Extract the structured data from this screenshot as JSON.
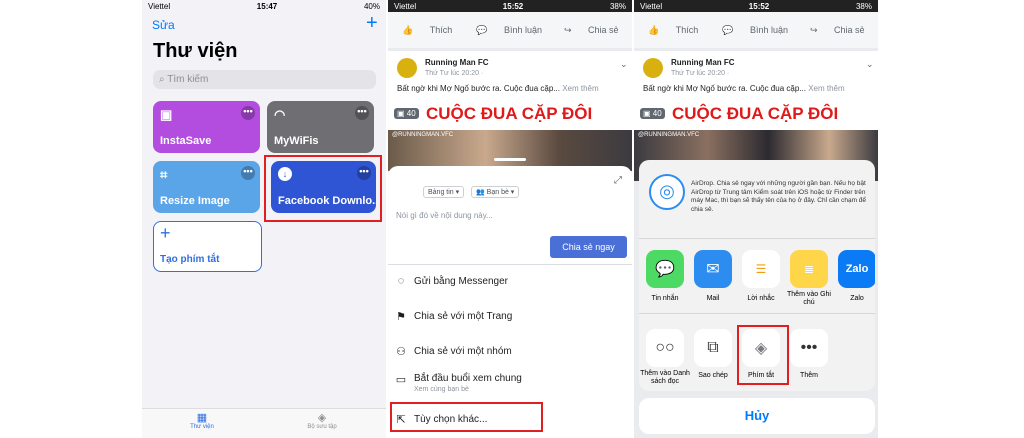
{
  "panel1": {
    "status": {
      "carrier": "Viettel",
      "time": "15:47",
      "battery": "40%"
    },
    "edit_label": "Sửa",
    "add_icon": "plus-icon",
    "title": "Thư viện",
    "search_placeholder": "Tìm kiếm",
    "shortcuts": [
      {
        "label": "InstaSave",
        "color": "#b34de0",
        "icon": "photo-icon"
      },
      {
        "label": "MyWiFis",
        "color": "#6e6e73",
        "icon": "wifi-icon"
      },
      {
        "label": "Resize Image",
        "color": "#5aa5e8",
        "icon": "crop-icon"
      },
      {
        "label": "Facebook Downlo...",
        "color": "#2f55d4",
        "icon": "download-icon"
      }
    ],
    "create_label": "Tạo phím tắt",
    "tabs": [
      {
        "label": "Thư viện",
        "icon": "grid-icon",
        "active": true
      },
      {
        "label": "Bộ sưu tập",
        "icon": "layers-icon",
        "active": false
      }
    ]
  },
  "panel2": {
    "status": {
      "carrier": "Viettel",
      "time": "15:52",
      "battery": "38%"
    },
    "actions": [
      "Thích",
      "Bình luận",
      "Chia sẻ"
    ],
    "post": {
      "page": "Running Man FC",
      "time": "Thứ Tư lúc 20:20 · ",
      "text": "Bất ngờ khi Mợ Ngố bước ra. Cuộc đua cặp...",
      "more": "Xem thêm",
      "count": "40",
      "banner": "CUỘC ĐUA CẶP ĐÔI",
      "watermark": "@RUNNINGMAN.VFC"
    },
    "sheet": {
      "audience1": "Bảng tin",
      "audience2": "Bạn bè",
      "placeholder": "Nói gì đó về nội dung này...",
      "share_now": "Chia sẻ ngay",
      "menu": [
        {
          "label": "Gửi bằng Messenger",
          "sub": "",
          "icon": "messenger-icon"
        },
        {
          "label": "Chia sẻ với một Trang",
          "sub": "",
          "icon": "flag-icon"
        },
        {
          "label": "Chia sẻ với một nhóm",
          "sub": "",
          "icon": "group-icon"
        },
        {
          "label": "Bắt đầu buổi xem chung",
          "sub": "Xem cùng bạn bè",
          "icon": "watch-party-icon"
        },
        {
          "label": "Tùy chọn khác...",
          "sub": "",
          "icon": "share-out-icon"
        }
      ]
    }
  },
  "panel3": {
    "status": {
      "carrier": "Viettel",
      "time": "15:52",
      "battery": "38%"
    },
    "actions": [
      "Thích",
      "Bình luận",
      "Chia sẻ"
    ],
    "post": {
      "page": "Running Man FC",
      "time": "Thứ Tư lúc 20:20 · ",
      "text": "Bất ngờ khi Mợ Ngố bước ra. Cuộc đua cặp...",
      "more": "Xem thêm",
      "count": "40",
      "banner": "CUỘC ĐUA CẶP ĐÔI",
      "watermark": "@RUNNINGMAN.VFC"
    },
    "airdrop_text": "AirDrop. Chia sẻ ngay với những người gần bạn. Nếu họ bật AirDrop từ Trung tâm Kiểm soát trên iOS hoặc từ Finder trên máy Mac, thì bạn sẽ thấy tên của họ ở đây. Chỉ cần chạm để chia sẻ.",
    "apps": [
      {
        "label": "Tin nhắn",
        "color": "#4cd964",
        "icon": "messages-icon"
      },
      {
        "label": "Mail",
        "color": "#2d8cf0",
        "icon": "mail-icon"
      },
      {
        "label": "Lời nhắc",
        "color": "#ffffff",
        "icon": "reminders-icon"
      },
      {
        "label": "Thêm vào Ghi chú",
        "color": "#ffd54a",
        "icon": "notes-icon"
      },
      {
        "label": "Zalo",
        "color": "#0a7bf5",
        "icon": "zalo-icon"
      }
    ],
    "zalo_text": "Zalo",
    "more_actions": [
      {
        "label": "Thêm vào Danh sách đọc",
        "icon": "glasses-icon"
      },
      {
        "label": "Sao chép",
        "icon": "copy-icon"
      },
      {
        "label": "Phím tắt",
        "icon": "shortcuts-icon"
      },
      {
        "label": "Thêm",
        "icon": "more-icon"
      }
    ],
    "cancel": "Hủy"
  },
  "colors": {
    "ios_blue": "#007aff",
    "fb_blue": "#4a6fd6",
    "highlight": "#e02020"
  }
}
